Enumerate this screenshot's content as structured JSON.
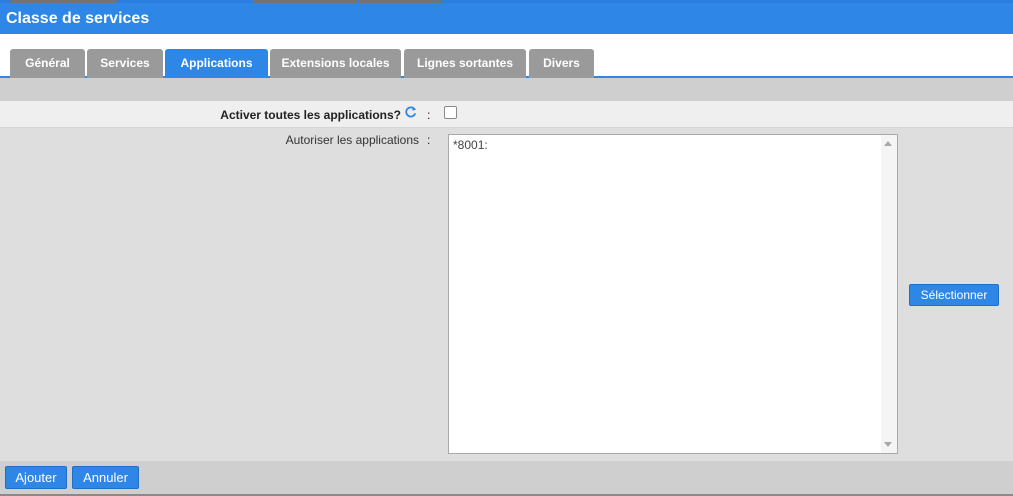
{
  "window": {
    "title": "Classe de services"
  },
  "tabs": [
    {
      "label": "Général",
      "active": false
    },
    {
      "label": "Services",
      "active": false
    },
    {
      "label": "Applications",
      "active": true
    },
    {
      "label": "Extensions locales",
      "active": false
    },
    {
      "label": "Lignes sortantes",
      "active": false
    },
    {
      "label": "Divers",
      "active": false
    }
  ],
  "form": {
    "activate_all": {
      "label": "Activer toutes les applications?",
      "colon": ":",
      "checked": false,
      "icon": "refresh-icon"
    },
    "allow_apps": {
      "label": "Autoriser les applications",
      "colon": ":",
      "value": "*8001:"
    },
    "select_button": "Sélectionner"
  },
  "footer": {
    "add_button": "Ajouter",
    "cancel_button": "Annuler"
  },
  "colors": {
    "accent": "#2e86e6",
    "tab_inactive": "#9a9a9a",
    "band": "#cfcfcf",
    "panel": "#dedede"
  }
}
